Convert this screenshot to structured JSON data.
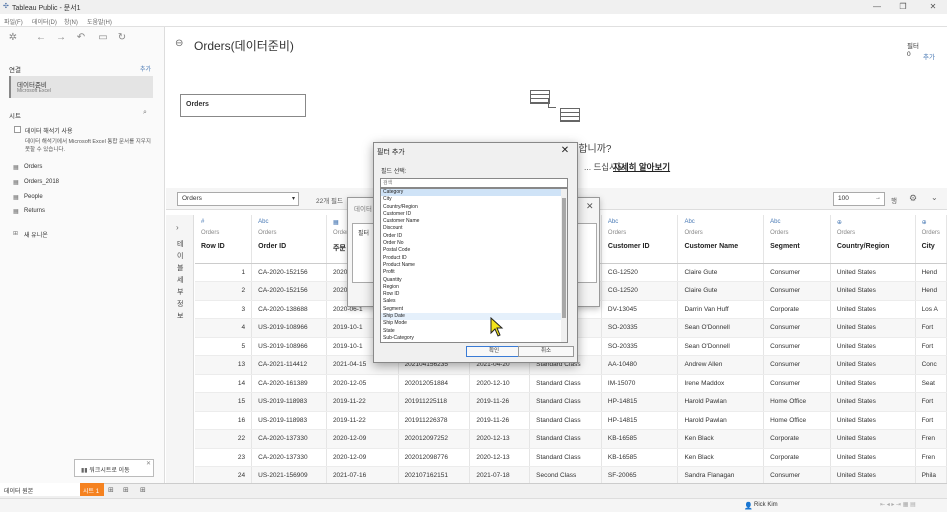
{
  "window": {
    "title": "Tableau Public - 문서1"
  },
  "menu": [
    "파일(F)",
    "데이터(D)",
    "창(N)",
    "도움말(H)"
  ],
  "left": {
    "connections_label": "연결",
    "add_label": "추가",
    "connection_name": "데이터준비",
    "connection_type": "Microsoft Excel",
    "sheets_label": "시트",
    "interpreter_label": "데이터 해석기 사용",
    "interpreter_desc": "데이터 해석기에서 Microsoft Excel 통합 문서를 지우지 못할 수 있습니다.",
    "sheets": [
      "Orders",
      "Orders_2018",
      "People",
      "Returns"
    ],
    "new_union": "새 유니온"
  },
  "main": {
    "title": "Orders(데이터준비)",
    "filters_label": "필터",
    "filters_count": "0",
    "filters_add": "추가",
    "table_box": "Orders",
    "hint_title": "이 관계는 데이터가 중요합니까?",
    "hint_body": "... 드십시오.",
    "learn_more": "자세히 알아보기",
    "select_value": "Orders",
    "fields_count": "22개 필드",
    "rows_value": "100",
    "rows_label": "행",
    "side_text": "테 이 블 세 부 정 보"
  },
  "columns": [
    {
      "type": "#",
      "table": "Orders",
      "field": "Row ID"
    },
    {
      "type": "Abc",
      "table": "Orders",
      "field": "Order ID"
    },
    {
      "type": "▦",
      "table": "Orders",
      "field": "주문"
    },
    {
      "type": "",
      "table": "",
      "field": ""
    },
    {
      "type": "",
      "table": "",
      "field": ""
    },
    {
      "type": "",
      "table": "",
      "field": ""
    },
    {
      "type": "Abc",
      "table": "Orders",
      "field": "Customer ID"
    },
    {
      "type": "Abc",
      "table": "Orders",
      "field": "Customer Name"
    },
    {
      "type": "Abc",
      "table": "Orders",
      "field": "Segment"
    },
    {
      "type": "⊕",
      "table": "Orders",
      "field": "Country/Region"
    },
    {
      "type": "⊕",
      "table": "Orders",
      "field": "City"
    }
  ],
  "rows": [
    [
      "1",
      "CA-2020-152156",
      "2020-",
      "",
      "",
      "",
      "CG-12520",
      "Claire Gute",
      "Consumer",
      "United States",
      "Hend"
    ],
    [
      "2",
      "CA-2020-152156",
      "2020-",
      "",
      "",
      "",
      "CG-12520",
      "Claire Gute",
      "Consumer",
      "United States",
      "Hend"
    ],
    [
      "3",
      "CA-2020-138688",
      "2020-06-1",
      "",
      "",
      "",
      "DV-13045",
      "Darrin Van Huff",
      "Corporate",
      "United States",
      "Los A"
    ],
    [
      "4",
      "US-2019-108966",
      "2019-10-1",
      "",
      "",
      "",
      "SO-20335",
      "Sean O'Donnell",
      "Consumer",
      "United States",
      "Fort"
    ],
    [
      "5",
      "US-2019-108966",
      "2019-10-1",
      "",
      "",
      "",
      "SO-20335",
      "Sean O'Donnell",
      "Consumer",
      "United States",
      "Fort"
    ],
    [
      "13",
      "CA-2021-114412",
      "2021-04-15",
      "202104156235",
      "2021-04-20",
      "Standard Class",
      "AA-10480",
      "Andrew Allen",
      "Consumer",
      "United States",
      "Conc"
    ],
    [
      "14",
      "CA-2020-161389",
      "2020-12-05",
      "202012051884",
      "2020-12-10",
      "Standard Class",
      "IM-15070",
      "Irene Maddox",
      "Consumer",
      "United States",
      "Seat"
    ],
    [
      "15",
      "US-2019-118983",
      "2019-11-22",
      "201911225118",
      "2019-11-26",
      "Standard Class",
      "HP-14815",
      "Harold Pawlan",
      "Home Office",
      "United States",
      "Fort"
    ],
    [
      "16",
      "US-2019-118983",
      "2019-11-22",
      "201911226378",
      "2019-11-26",
      "Standard Class",
      "HP-14815",
      "Harold Pawlan",
      "Home Office",
      "United States",
      "Fort"
    ],
    [
      "22",
      "CA-2020-137330",
      "2020-12-09",
      "202012097252",
      "2020-12-13",
      "Standard Class",
      "KB-16585",
      "Ken Black",
      "Corporate",
      "United States",
      "Fren"
    ],
    [
      "23",
      "CA-2020-137330",
      "2020-12-09",
      "202012098776",
      "2020-12-13",
      "Standard Class",
      "KB-16585",
      "Ken Black",
      "Corporate",
      "United States",
      "Fren"
    ],
    [
      "24",
      "US-2021-156909",
      "2021-07-16",
      "202107162151",
      "2021-07-18",
      "Second Class",
      "SF-20065",
      "Sandra Flanagan",
      "Consumer",
      "United States",
      "Phila"
    ]
  ],
  "dialog_back": {
    "title": "데이터",
    "label": "필터"
  },
  "dialog": {
    "title": "필터 추가",
    "field_label": "필드 선택:",
    "search_placeholder": "검색",
    "items": [
      "Category",
      "City",
      "Country/Region",
      "Customer ID",
      "Customer Name",
      "Discount",
      "Order ID",
      "Order No",
      "Postal Code",
      "Product ID",
      "Product Name",
      "Profit",
      "Quantity",
      "Region",
      "Row ID",
      "Sales",
      "Segment",
      "Ship Date",
      "Ship Mode",
      "State",
      "Sub-Category"
    ],
    "ok": "확인",
    "cancel": "취소"
  },
  "status": {
    "datasource_tab": "데이터 원본",
    "sheet_tab": "시트 1",
    "tooltip": "워크시트로 이동",
    "user": "Rick Kim"
  }
}
